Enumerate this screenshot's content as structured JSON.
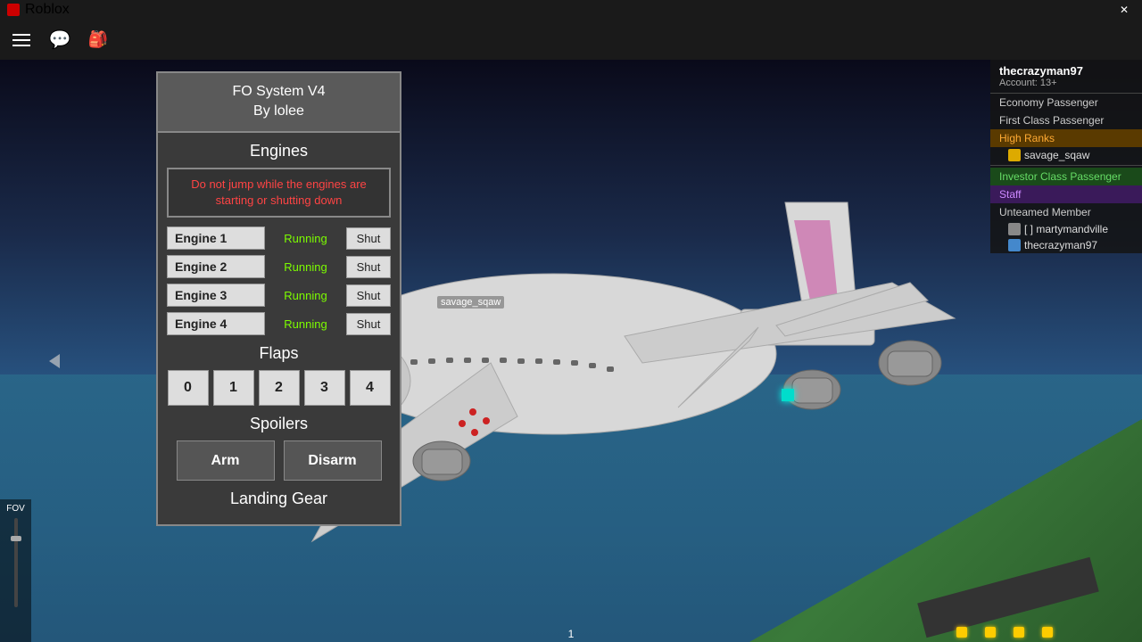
{
  "titlebar": {
    "title": "Roblox",
    "close_label": "✕"
  },
  "topbar": {
    "icons": [
      "menu",
      "chat",
      "bag"
    ]
  },
  "fo_system": {
    "title_line1": "FO System V4",
    "title_line2": "By lolee",
    "engines_title": "Engines",
    "warning_text": "Do not jump while the engines are starting or shutting down",
    "engines": [
      {
        "label": "Engine 1",
        "status": "Running",
        "shut": "Shut"
      },
      {
        "label": "Engine 2",
        "status": "Running",
        "shut": "Shut"
      },
      {
        "label": "Engine 3",
        "status": "Running",
        "shut": "Shut"
      },
      {
        "label": "Engine 4",
        "status": "Running",
        "shut": "Shut"
      }
    ],
    "flaps_title": "Flaps",
    "flap_buttons": [
      "0",
      "1",
      "2",
      "3",
      "4"
    ],
    "spoilers_title": "Spoilers",
    "arm_label": "Arm",
    "disarm_label": "Disarm",
    "landing_gear_title": "Landing Gear"
  },
  "player_panel": {
    "account_name": "thecrazyman97",
    "account_type": "Account: 13+",
    "categories": [
      {
        "label": "Economy Passenger",
        "class": "economy"
      },
      {
        "label": "First Class Passenger",
        "class": "first-class"
      },
      {
        "label": "High Ranks",
        "class": "high-ranks"
      },
      {
        "label": "savage_sqaw",
        "type": "player",
        "avatar": "yellow"
      },
      {
        "label": "Investor Class Passenger",
        "class": "investor"
      },
      {
        "label": "Staff",
        "class": "staff"
      },
      {
        "label": "Unteamed Member",
        "class": "unteamed"
      },
      {
        "label": "[ ] martymandville",
        "type": "player",
        "avatar": "gray"
      },
      {
        "label": "thecrazyman97",
        "type": "player",
        "avatar": "blue"
      }
    ]
  },
  "nametag": "savage_sqaw",
  "fov": {
    "label": "FOV"
  },
  "page_number": "1"
}
